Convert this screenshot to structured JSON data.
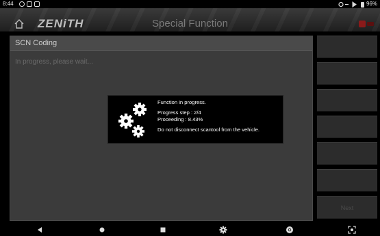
{
  "statusbar": {
    "time": "8:44",
    "battery": "96%"
  },
  "header": {
    "logo": "ZENiTH",
    "title": "Special Function"
  },
  "panel": {
    "title": "SCN Coding",
    "status": "In progress, please wait..."
  },
  "popup": {
    "line1": "Function in progress.",
    "line2": "Progress step : 2/4",
    "line3": "Proceeding : 8.43%",
    "line4": "Do not disconnect scantool from the vehicle."
  },
  "sidebar": {
    "buttons": [
      "",
      "",
      "",
      "",
      "",
      "",
      "Next"
    ]
  },
  "icons": {
    "home": "home-icon",
    "vci": "vci-connection-icon",
    "gears": "gears-icon",
    "nav": [
      "back-icon",
      "home-nav-icon",
      "recents-icon",
      "settings-icon",
      "chrome-icon",
      "screenshot-icon"
    ]
  },
  "colors": {
    "panel": "#3b3b3b",
    "popup": "#000000",
    "vci": "#8b1a1a"
  }
}
